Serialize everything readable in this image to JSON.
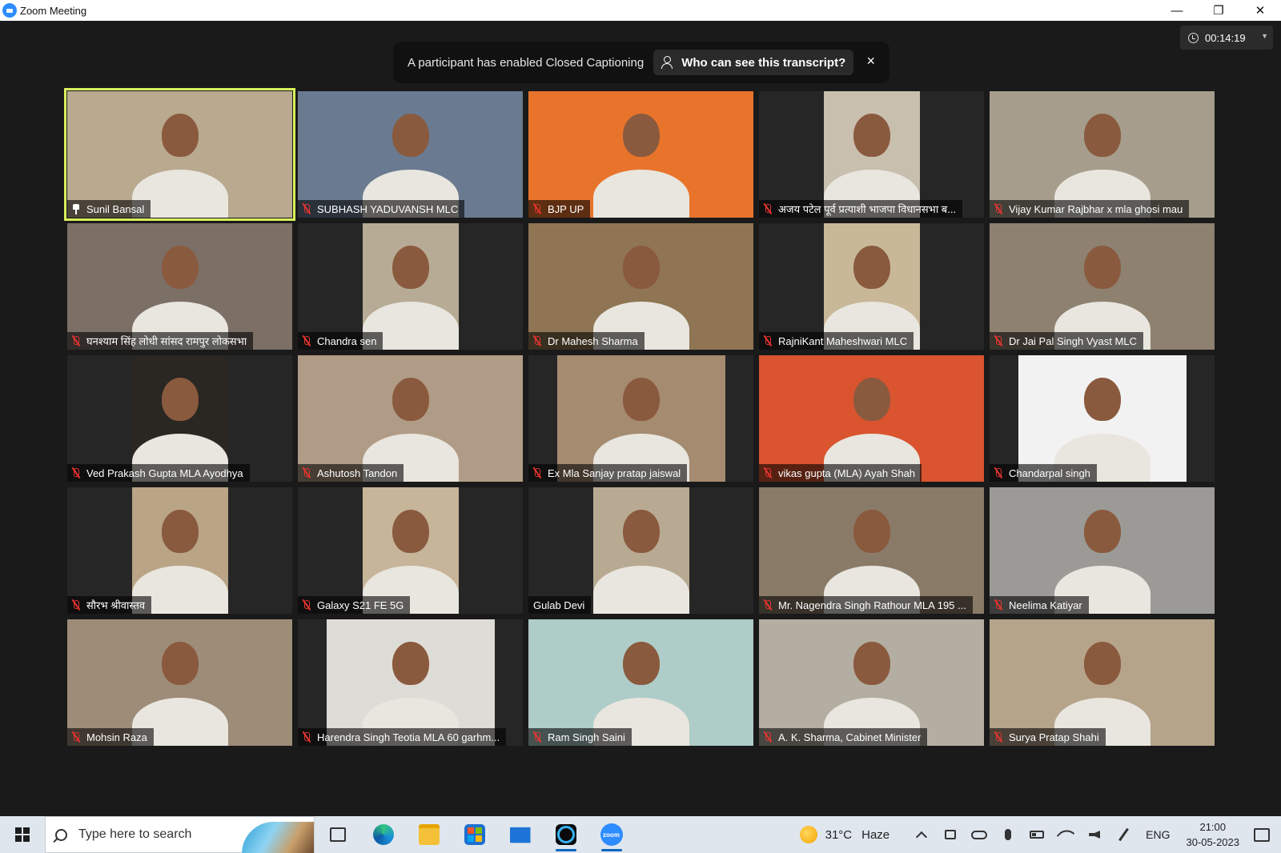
{
  "window": {
    "title": "Zoom Meeting",
    "controls": {
      "minimize": "—",
      "restore": "❐",
      "close": "✕"
    }
  },
  "meeting": {
    "timer": "00:14:19",
    "banner": {
      "message": "A participant has enabled Closed Captioning",
      "who_button": "Who can see this transcript?",
      "close": "×"
    },
    "participants": [
      {
        "name": "Sunil Bansal",
        "muted": false,
        "pinned": true,
        "active_speaker": true,
        "bg": "#b8a98f",
        "video_width": 281
      },
      {
        "name": "SUBHASH YADUVANSH MLC",
        "muted": true,
        "bg": "#6a7a90",
        "video_width": 281
      },
      {
        "name": "BJP UP",
        "muted": true,
        "bg": "#e8742c",
        "video_width": 281
      },
      {
        "name": "अजय पटेल पूर्व प्रत्याशी भाजपा विधानसभा ब...",
        "muted": true,
        "bg": "#c9bfae",
        "video_width": 120
      },
      {
        "name": "Vijay Kumar Rajbhar x mla ghosi mau",
        "muted": true,
        "bg": "#a69d8c",
        "video_width": 281
      },
      {
        "name": "घनश्याम सिंह लोधी  सांसद रामपुर लोकसभा",
        "muted": true,
        "bg": "#7c6f66",
        "video_width": 281
      },
      {
        "name": "Chandra sen",
        "muted": true,
        "bg": "#b7ab95",
        "video_width": 120
      },
      {
        "name": "Dr Mahesh Sharma",
        "muted": true,
        "bg": "#8f7553",
        "video_width": 281
      },
      {
        "name": "RajniKant Maheshwari  MLC",
        "muted": true,
        "bg": "#c8b898",
        "video_width": 120
      },
      {
        "name": "Dr Jai Pal Singh Vyast MLC",
        "muted": true,
        "bg": "#8e8170",
        "video_width": 281
      },
      {
        "name": "Ved Prakash Gupta MLA Ayodhya",
        "muted": true,
        "bg": "#2a2722",
        "video_width": 120
      },
      {
        "name": "Ashutosh Tandon",
        "muted": true,
        "bg": "#b09c86",
        "video_width": 281
      },
      {
        "name": "Ex  Mla Sanjay pratap jaiswal",
        "muted": true,
        "bg": "#a58b70",
        "video_width": 210
      },
      {
        "name": "vikas gupta (MLA) Ayah Shah",
        "muted": true,
        "bg": "#d9542f",
        "video_width": 281
      },
      {
        "name": "Chandarpal singh",
        "muted": true,
        "bg": "#f2f2f2",
        "video_width": 210
      },
      {
        "name": "सौरभ श्रीवास्तव",
        "muted": true,
        "bg": "#b9a486",
        "video_width": 120
      },
      {
        "name": "Galaxy S21 FE 5G",
        "muted": true,
        "bg": "#c7b59a",
        "video_width": 120
      },
      {
        "name": "Gulab Devi",
        "muted": false,
        "bg": "#b8aa92",
        "video_width": 120
      },
      {
        "name": "Mr. Nagendra Singh Rathour MLA 195 ...",
        "muted": true,
        "bg": "#8a7a68",
        "video_width": 281
      },
      {
        "name": "Neelima Katiyar",
        "muted": true,
        "bg": "#9b9a96",
        "video_width": 281
      },
      {
        "name": "Mohsin Raza",
        "muted": true,
        "bg": "#9d8c78",
        "video_width": 281
      },
      {
        "name": "Harendra Singh Teotia MLA 60 garhm...",
        "muted": true,
        "bg": "#dedcd6",
        "video_width": 210
      },
      {
        "name": "Ram Singh Saini",
        "muted": true,
        "bg": "#aeccc8",
        "video_width": 281
      },
      {
        "name": "A. K. Sharma, Cabinet Minister",
        "muted": true,
        "bg": "#b3aea1",
        "video_width": 281
      },
      {
        "name": "Surya Pratap Shahi",
        "muted": true,
        "bg": "#b6a48a",
        "video_width": 281
      }
    ]
  },
  "taskbar": {
    "search_placeholder": "Type here to search",
    "apps": [
      "task-view",
      "edge",
      "file-explorer",
      "microsoft-store",
      "mail",
      "webex",
      "zoom"
    ],
    "zoom_label": "zoom",
    "weather": {
      "temp": "31°C",
      "condition": "Haze"
    },
    "language": "ENG",
    "time": "21:00",
    "date": "30-05-2023"
  }
}
